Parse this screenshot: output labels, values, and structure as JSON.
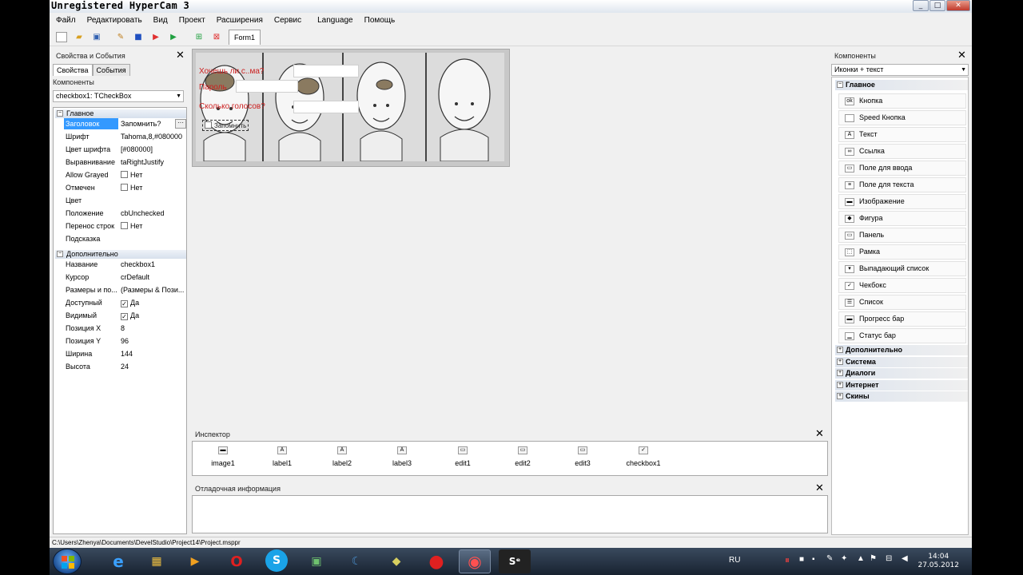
{
  "window": {
    "title": "Unregistered HyperCam 3",
    "btn_min": "_",
    "btn_max": "□",
    "btn_close": "✕"
  },
  "menu": [
    "Файл",
    "Редактировать",
    "Вид",
    "Проект",
    "Расширения",
    "Сервис",
    "Language",
    "Помощь"
  ],
  "doc_tab": "Form1",
  "props_panel": {
    "title": "Свойства и События",
    "tabs": [
      "Свойства",
      "События"
    ],
    "components_label": "Компоненты",
    "selected_component": "checkbox1: TCheckBox",
    "cat_main": "Главное",
    "cat_extra": "Дополнительно",
    "main_rows": [
      {
        "key": "Заголовок",
        "value": "Запомнить?"
      },
      {
        "key": "Шрифт",
        "value": "Tahoma,8,#080000"
      },
      {
        "key": "Цвет шрифта",
        "value": "[#080000]"
      },
      {
        "key": "Выравнивание",
        "value": "taRightJustify"
      },
      {
        "key": "Allow Grayed",
        "value": "Нет"
      },
      {
        "key": "Отмечен",
        "value": "Нет"
      },
      {
        "key": "Цвет",
        "value": ""
      },
      {
        "key": "Положение",
        "value": "cbUnchecked"
      },
      {
        "key": "Перенос строк",
        "value": "Нет"
      },
      {
        "key": "Подсказка",
        "value": ""
      }
    ],
    "extra_rows": [
      {
        "key": "Название",
        "value": "checkbox1"
      },
      {
        "key": "Курсор",
        "value": "crDefault"
      },
      {
        "key": "Размеры и по...",
        "value": "(Размеры & Пози..."
      },
      {
        "key": "Доступный",
        "value": "Да"
      },
      {
        "key": "Видимый",
        "value": "Да"
      },
      {
        "key": "Позиция X",
        "value": "8"
      },
      {
        "key": "Позиция Y",
        "value": "96"
      },
      {
        "key": "Ширина",
        "value": "144"
      },
      {
        "key": "Высота",
        "value": "24"
      }
    ]
  },
  "form_preview": {
    "label1": "Хочешь ли с..ма?",
    "label2": "Пароль",
    "label3": "Сколько голосов?",
    "checkbox": "Запомнить"
  },
  "components_panel": {
    "title": "Компоненты",
    "view_mode": "Иконки + текст",
    "cat_main": "Главное",
    "items": [
      {
        "label": "Кнопка",
        "icon": "ok"
      },
      {
        "label": "Speed Кнопка",
        "icon": ""
      },
      {
        "label": "Текст",
        "icon": "A"
      },
      {
        "label": "Ссылка",
        "icon": "∞"
      },
      {
        "label": "Поле для ввода",
        "icon": "▭"
      },
      {
        "label": "Поле для текста",
        "icon": "≡"
      },
      {
        "label": "Изображение",
        "icon": "▬"
      },
      {
        "label": "Фигура",
        "icon": "◆"
      },
      {
        "label": "Панель",
        "icon": "▭"
      },
      {
        "label": "Рамка",
        "icon": "⬚"
      },
      {
        "label": "Выпадающий список",
        "icon": "▾"
      },
      {
        "label": "Чекбокс",
        "icon": "✓"
      },
      {
        "label": "Список",
        "icon": "☰"
      },
      {
        "label": "Прогресс бар",
        "icon": "▬"
      },
      {
        "label": "Статус бар",
        "icon": "▁"
      }
    ],
    "categories": [
      "Дополнительно",
      "Система",
      "Диалоги",
      "Интернет",
      "Скины"
    ]
  },
  "inspector": {
    "title": "Инспектор",
    "items": [
      {
        "label": "image1",
        "icon": "▬"
      },
      {
        "label": "label1",
        "icon": "A"
      },
      {
        "label": "label2",
        "icon": "A"
      },
      {
        "label": "label3",
        "icon": "A"
      },
      {
        "label": "edit1",
        "icon": "▭"
      },
      {
        "label": "edit2",
        "icon": "▭"
      },
      {
        "label": "edit3",
        "icon": "▭"
      },
      {
        "label": "checkbox1",
        "icon": "✓"
      }
    ]
  },
  "debug": {
    "title": "Отладочная информация"
  },
  "statusbar": {
    "path": "C:\\Users\\Zhenya\\Documents\\DevelStudio\\Project14\\Project.msppr"
  },
  "taskbar": {
    "lang": "RU",
    "time": "14:04",
    "date": "27.05.2012",
    "apps": [
      "e",
      "▦",
      "▶",
      "O",
      "S",
      "▣",
      "☾",
      "◆",
      "●",
      "◉",
      "Sᵉ"
    ]
  }
}
